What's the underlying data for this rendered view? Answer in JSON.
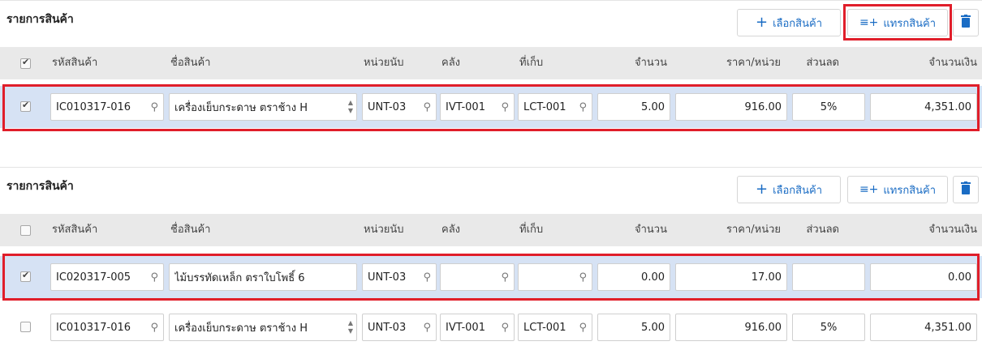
{
  "colors": {
    "accent": "#1a6cc4",
    "highlight": "#e01e2a",
    "selected_row": "#d6e2f4",
    "header_bg": "#e9e9e9"
  },
  "panels": [
    {
      "title": "รายการสินค้า",
      "buttons": {
        "select_label": "เลือกสินค้า",
        "insert_label": "แทรกสินค้า",
        "select_icon": "plus-icon",
        "insert_icon": "list-add-icon",
        "delete_icon": "trash-icon"
      },
      "header_checked": true,
      "columns": [
        "รหัสสินค้า",
        "ชื่อสินค้า",
        "หน่วยนับ",
        "คลัง",
        "ที่เก็บ",
        "จำนวน",
        "ราคา/หน่วย",
        "ส่วนลด",
        "จำนวนเงิน"
      ],
      "rows": [
        {
          "checked": true,
          "code": "IC010317-016",
          "name": "เครื่องเย็บกระดาษ ตราช้าง H",
          "unit": "UNT-03",
          "warehouse": "IVT-001",
          "location": "LCT-001",
          "qty": "5.00",
          "price": "916.00",
          "discount": "5%",
          "amount": "4,351.00"
        }
      ]
    },
    {
      "title": "รายการสินค้า",
      "buttons": {
        "select_label": "เลือกสินค้า",
        "insert_label": "แทรกสินค้า",
        "select_icon": "plus-icon",
        "insert_icon": "list-add-icon",
        "delete_icon": "trash-icon"
      },
      "header_checked": false,
      "columns": [
        "รหัสสินค้า",
        "ชื่อสินค้า",
        "หน่วยนับ",
        "คลัง",
        "ที่เก็บ",
        "จำนวน",
        "ราคา/หน่วย",
        "ส่วนลด",
        "จำนวนเงิน"
      ],
      "rows": [
        {
          "checked": true,
          "code": "IC020317-005",
          "name": "ไม้บรรทัดเหล็ก ตราใบโพธิ์ 6",
          "unit": "UNT-03",
          "warehouse": "",
          "location": "",
          "qty": "0.00",
          "price": "17.00",
          "discount": "",
          "amount": "0.00"
        },
        {
          "checked": false,
          "code": "IC010317-016",
          "name": "เครื่องเย็บกระดาษ ตราช้าง H",
          "unit": "UNT-03",
          "warehouse": "IVT-001",
          "location": "LCT-001",
          "qty": "5.00",
          "price": "916.00",
          "discount": "5%",
          "amount": "4,351.00"
        }
      ]
    }
  ]
}
